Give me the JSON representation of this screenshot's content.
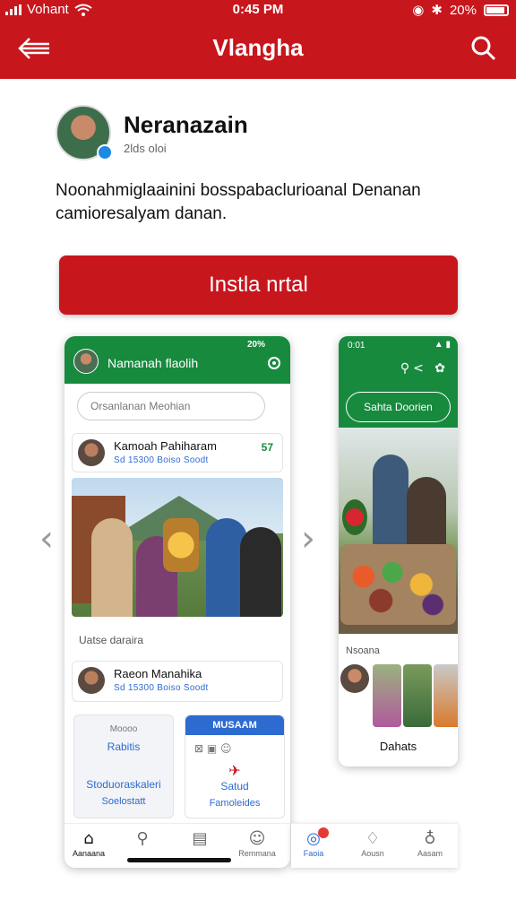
{
  "status_bar": {
    "carrier": "Vohant",
    "time": "0:45 PM",
    "battery": "20%"
  },
  "header": {
    "title": "Vlangha"
  },
  "profile": {
    "name": "Neranazain",
    "subtitle": "2lds oloi"
  },
  "description": "Noonahmiglaainini bosspabaclurioanal Denanan camioresalyam danan.",
  "install_button": {
    "label": "Instla nrtal"
  },
  "phone1": {
    "status": "20%",
    "title": "Namanah flaolih",
    "search_placeholder": "Orsanlanan Meohian",
    "post1": {
      "name": "Kamoah Pahiharam",
      "meta": "Sd 15300 Boiso Soodt",
      "count": "57"
    },
    "caption": "Uatse daraira",
    "post2": {
      "name": "Raeon Manahika",
      "meta": "Sd 15300 Boiso Soodt"
    },
    "tile_left": {
      "top": "Moooo",
      "title": "Rabitis",
      "line1": "Stoduoraskaleri",
      "line2": "Soelostatt"
    },
    "tile_right": {
      "header": "MUSAAM",
      "title": "Satud",
      "line": "Famoleides"
    },
    "nav": [
      {
        "label": "Aanaana",
        "icon": "home-icon"
      },
      {
        "label": "",
        "icon": "search-icon"
      },
      {
        "label": "",
        "icon": "calendar-icon"
      },
      {
        "label": "Remmana",
        "icon": "chat-icon"
      }
    ]
  },
  "phone2": {
    "time": "0:01",
    "button": "Sahta Doorien",
    "label": "Nsoana",
    "footer": "Dahats"
  },
  "nav2": [
    {
      "label": "Faoia",
      "icon": "compass-icon",
      "badge": ""
    },
    {
      "label": "Aousn",
      "icon": "bell-icon"
    },
    {
      "label": "Aasam",
      "icon": "profile-icon"
    }
  ],
  "colors": {
    "brand_red": "#c8161d",
    "green": "#178a3e"
  }
}
